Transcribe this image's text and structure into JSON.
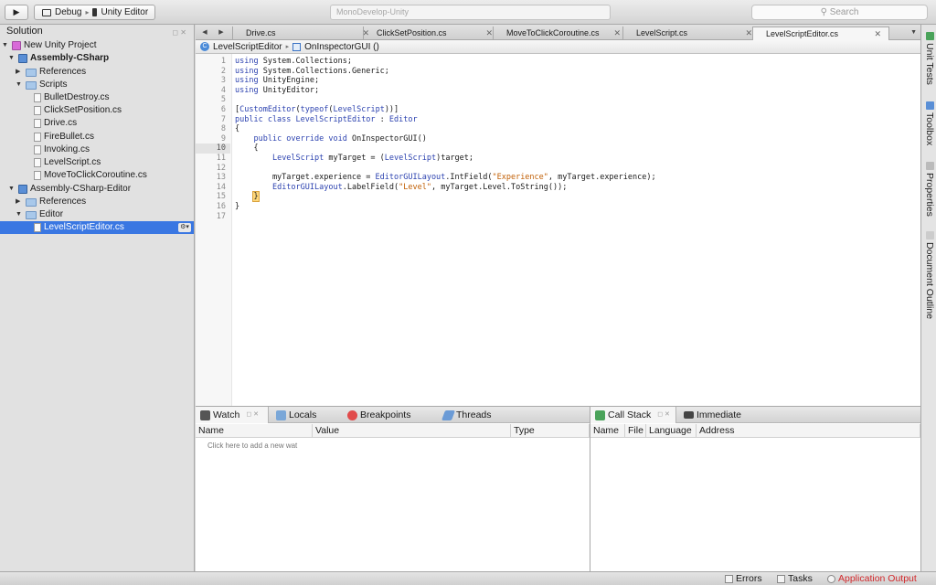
{
  "toolbar": {
    "run_icon": "play-icon",
    "config": "Debug",
    "target": "Unity Editor",
    "status": "MonoDevelop-Unity",
    "search_placeholder": "Search"
  },
  "solution": {
    "title": "Solution",
    "items": [
      {
        "label": "New Unity Project",
        "icon": "solution-icon"
      },
      {
        "label": "Assembly-CSharp",
        "icon": "project-icon"
      },
      {
        "label": "References",
        "icon": "folder-icon"
      },
      {
        "label": "Scripts",
        "icon": "folder-icon"
      },
      {
        "label": "BulletDestroy.cs",
        "icon": "file-icon"
      },
      {
        "label": "ClickSetPosition.cs",
        "icon": "file-icon"
      },
      {
        "label": "Drive.cs",
        "icon": "file-icon"
      },
      {
        "label": "FireBullet.cs",
        "icon": "file-icon"
      },
      {
        "label": "Invoking.cs",
        "icon": "file-icon"
      },
      {
        "label": "LevelScript.cs",
        "icon": "file-icon"
      },
      {
        "label": "MoveToClickCoroutine.cs",
        "icon": "file-icon"
      },
      {
        "label": "Assembly-CSharp-Editor",
        "icon": "project-icon"
      },
      {
        "label": "References",
        "icon": "folder-icon"
      },
      {
        "label": "Editor",
        "icon": "folder-icon"
      },
      {
        "label": "LevelScriptEditor.cs",
        "icon": "file-icon"
      }
    ]
  },
  "tabs": [
    "Drive.cs",
    "ClickSetPosition.cs",
    "MoveToClickCoroutine.cs",
    "LevelScript.cs",
    "LevelScriptEditor.cs"
  ],
  "breadcrumb": {
    "class_name": "LevelScriptEditor",
    "method_name": "OnInspectorGUI ()"
  },
  "code": {
    "current_line": 10,
    "line_numbers": [
      "1",
      "2",
      "3",
      "4",
      "5",
      "6",
      "7",
      "8",
      "9",
      "10",
      "11",
      "12",
      "13",
      "14",
      "15",
      "16",
      "17"
    ]
  },
  "bottom_left": {
    "tabs": [
      "Watch",
      "Locals",
      "Breakpoints",
      "Threads"
    ],
    "columns": [
      "Name",
      "Value",
      "Type"
    ],
    "hint": "Click here to add a new wat"
  },
  "bottom_right": {
    "tabs": [
      "Call Stack",
      "Immediate"
    ],
    "columns": [
      "Name",
      "File",
      "Language",
      "Address"
    ]
  },
  "right_pads": [
    "Unit Tests",
    "Toolbox",
    "Properties",
    "Document Outline"
  ],
  "statusbar": {
    "errors": "Errors",
    "tasks": "Tasks",
    "app_output": "Application Output"
  },
  "colors": {
    "selection": "#3a77e2",
    "keyword": "#2d43b0",
    "string": "#c15f05",
    "app_output": "#d2282b"
  }
}
